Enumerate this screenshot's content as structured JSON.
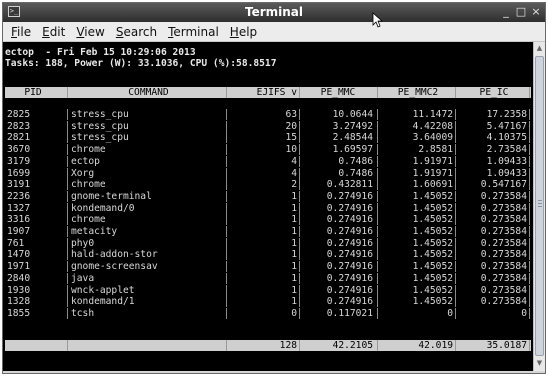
{
  "window": {
    "title": "Terminal",
    "minimize": "_",
    "maximize": "□",
    "close": "×"
  },
  "menubar": {
    "items": [
      {
        "label": "File",
        "mnemonic": "F"
      },
      {
        "label": "Edit",
        "mnemonic": "E"
      },
      {
        "label": "View",
        "mnemonic": "V"
      },
      {
        "label": "Search",
        "mnemonic": "S"
      },
      {
        "label": "Terminal",
        "mnemonic": "T"
      },
      {
        "label": "Help",
        "mnemonic": "H"
      }
    ]
  },
  "status": {
    "line1": "ectop  - Fri Feb 15 10:29:06 2013",
    "line2": "Tasks: 188, Power (W): 33.1036, CPU (%):58.8517"
  },
  "table": {
    "headers": [
      "PID",
      "COMMAND",
      "EJIFS v",
      "PE_MMC",
      "PE_MMC2",
      "PE_IC"
    ],
    "rows": [
      [
        "2825",
        "stress_cpu",
        "63",
        "10.0644",
        "11.1472",
        "17.2358"
      ],
      [
        "2823",
        "stress_cpu",
        "20",
        "3.27492",
        "4.42208",
        "5.47167"
      ],
      [
        "2821",
        "stress_cpu",
        "15",
        "2.48544",
        "3.64009",
        "4.10375"
      ],
      [
        "3670",
        "chrome",
        "10",
        "1.69597",
        "2.8581",
        "2.73584"
      ],
      [
        "3179",
        "ectop",
        "4",
        "0.7486",
        "1.91971",
        "1.09433"
      ],
      [
        "1699",
        "Xorg",
        "4",
        "0.7486",
        "1.91971",
        "1.09433"
      ],
      [
        "3191",
        "chrome",
        "2",
        "0.432811",
        "1.60691",
        "0.547167"
      ],
      [
        "2236",
        "gnome-terminal",
        "1",
        "0.274916",
        "1.45052",
        "0.273584"
      ],
      [
        "1327",
        "kondemand/0",
        "1",
        "0.274916",
        "1.45052",
        "0.273584"
      ],
      [
        "3316",
        "chrome",
        "1",
        "0.274916",
        "1.45052",
        "0.273584"
      ],
      [
        "1907",
        "metacity",
        "1",
        "0.274916",
        "1.45052",
        "0.273584"
      ],
      [
        "761",
        "phy0",
        "1",
        "0.274916",
        "1.45052",
        "0.273584"
      ],
      [
        "1470",
        "hald-addon-stor",
        "1",
        "0.274916",
        "1.45052",
        "0.273584"
      ],
      [
        "1971",
        "gnome-screensav",
        "1",
        "0.274916",
        "1.45052",
        "0.273584"
      ],
      [
        "2840",
        "java",
        "1",
        "0.274916",
        "1.45052",
        "0.273584"
      ],
      [
        "1930",
        "wnck-applet",
        "1",
        "0.274916",
        "1.45052",
        "0.273584"
      ],
      [
        "1328",
        "kondemand/1",
        "1",
        "0.274916",
        "1.45052",
        "0.273584"
      ],
      [
        "1855",
        "tcsh",
        "0",
        "0.117021",
        "0",
        "0"
      ]
    ],
    "totals": [
      "",
      "",
      "128",
      "42.2105",
      "42.019",
      "35.0187"
    ]
  },
  "colors": {
    "terminal_bg": "#000000",
    "terminal_fg": "#d8d8d8",
    "header_bg": "#cfcfcf",
    "titlebar": "#3a3a3a"
  }
}
